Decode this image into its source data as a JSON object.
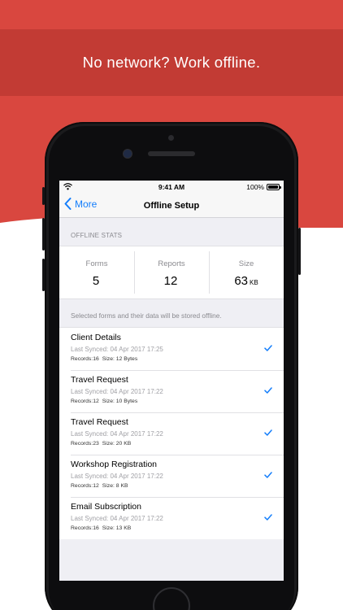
{
  "banner": {
    "text": "No network? Work offline."
  },
  "status_bar": {
    "time": "9:41 AM",
    "battery": "100%"
  },
  "nav": {
    "back_label": "More",
    "title": "Offline Setup"
  },
  "stats_section": {
    "header": "OFFLINE STATS",
    "items": [
      {
        "label": "Forms",
        "value": "5",
        "unit": ""
      },
      {
        "label": "Reports",
        "value": "12",
        "unit": ""
      },
      {
        "label": "Size",
        "value": "63",
        "unit": "KB"
      }
    ]
  },
  "forms_section": {
    "note": "Selected forms and their data will be stored offline.",
    "records_label": "Records:",
    "size_label": "Size:",
    "items": [
      {
        "title": "Client Details",
        "synced": "Last Synced: 04 Apr 2017 17:25",
        "records": "16",
        "size": "12",
        "size_unit": "Bytes"
      },
      {
        "title": "Travel Request",
        "synced": "Last Synced: 04 Apr 2017 17:22",
        "records": "12",
        "size": "10",
        "size_unit": "Bytes"
      },
      {
        "title": "Travel Request",
        "synced": "Last Synced: 04 Apr 2017 17:22",
        "records": "23",
        "size": "20",
        "size_unit": "KB"
      },
      {
        "title": "Workshop Registration",
        "synced": "Last Synced: 04 Apr 2017 17:22",
        "records": "12",
        "size": "8",
        "size_unit": "KB"
      },
      {
        "title": "Email Subscription",
        "synced": "Last Synced: 04 Apr 2017 17:22",
        "records": "16",
        "size": "13",
        "size_unit": "KB"
      }
    ]
  },
  "colors": {
    "background_red": "#d9473f",
    "banner_red": "#c23b34",
    "ios_blue": "#147efb"
  },
  "icons": {
    "back": "chevron-left-icon",
    "check": "checkmark-icon",
    "wifi": "wifi-icon",
    "battery": "battery-icon"
  }
}
